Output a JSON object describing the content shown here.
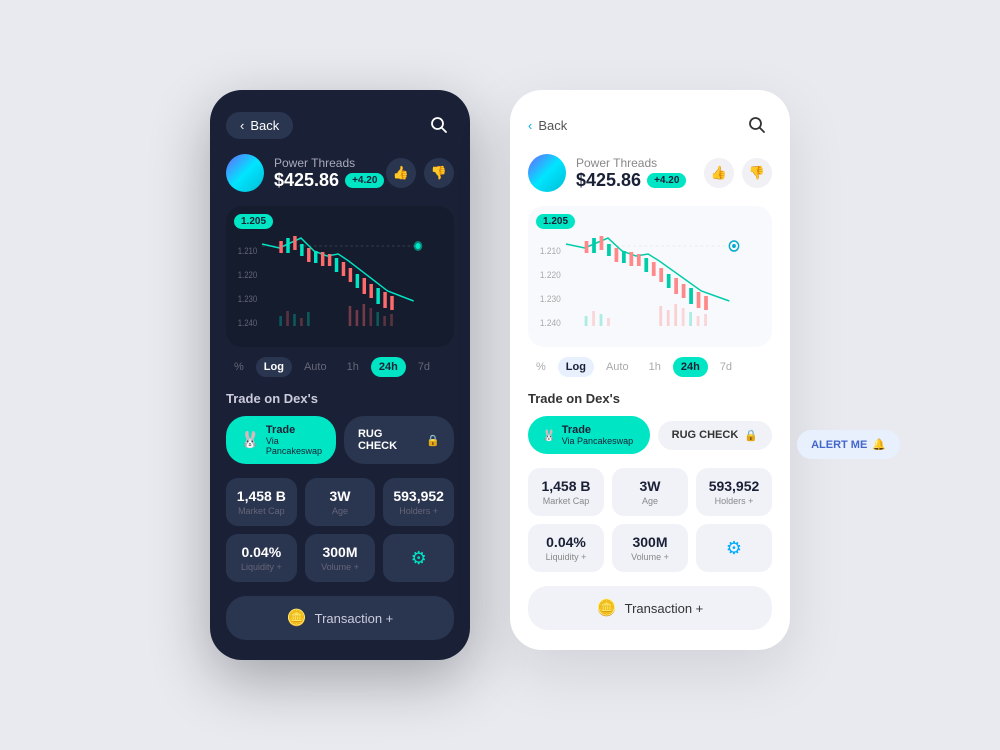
{
  "dark_card": {
    "back_label": "Back",
    "token_name": "Power Threads",
    "token_price": "$425.86",
    "token_change": "+4.20",
    "chart_label": "1.205",
    "chart_y_labels": [
      "1.210",
      "1.220",
      "1.230",
      "1.240"
    ],
    "tabs": [
      "%",
      "Log",
      "Auto",
      "1h",
      "24h",
      "7d"
    ],
    "active_tab": "24h",
    "active_tab2": "Log",
    "trade_section_label": "Trade on Dex's",
    "trade_btn_label": "Trade",
    "trade_btn_sub": "Via Pancakeswap",
    "rug_btn_label": "RUG CHECK",
    "stats": [
      {
        "value": "1,458 B",
        "label": "Market Cap"
      },
      {
        "value": "3W",
        "label": "Age"
      },
      {
        "value": "593,952",
        "label": "Holders +"
      }
    ],
    "stats2": [
      {
        "value": "0.04%",
        "label": "Liquidity +"
      },
      {
        "value": "300M",
        "label": "Volume +"
      }
    ],
    "txn_label": "Transaction +"
  },
  "light_card": {
    "back_label": "Back",
    "token_name": "Power Threads",
    "token_price": "$425.86",
    "token_change": "+4.20",
    "chart_label": "1.205",
    "chart_y_labels": [
      "1.210",
      "1.220",
      "1.230",
      "1.240"
    ],
    "tabs": [
      "%",
      "Log",
      "Auto",
      "1h",
      "24h",
      "7d"
    ],
    "active_tab": "24h",
    "active_tab2": "Log",
    "trade_section_label": "Trade on Dex's",
    "trade_btn_label": "Trade",
    "trade_btn_sub": "Via Pancakeswap",
    "rug_btn_label": "RUG CHECK",
    "alert_btn_label": "ALERT ME",
    "stats": [
      {
        "value": "1,458 B",
        "label": "Market Cap"
      },
      {
        "value": "3W",
        "label": "Age"
      },
      {
        "value": "593,952",
        "label": "Holders +"
      }
    ],
    "stats2": [
      {
        "value": "0.04%",
        "label": "Liquidity +"
      },
      {
        "value": "300M",
        "label": "Volume +"
      }
    ],
    "txn_label": "Transaction +"
  }
}
